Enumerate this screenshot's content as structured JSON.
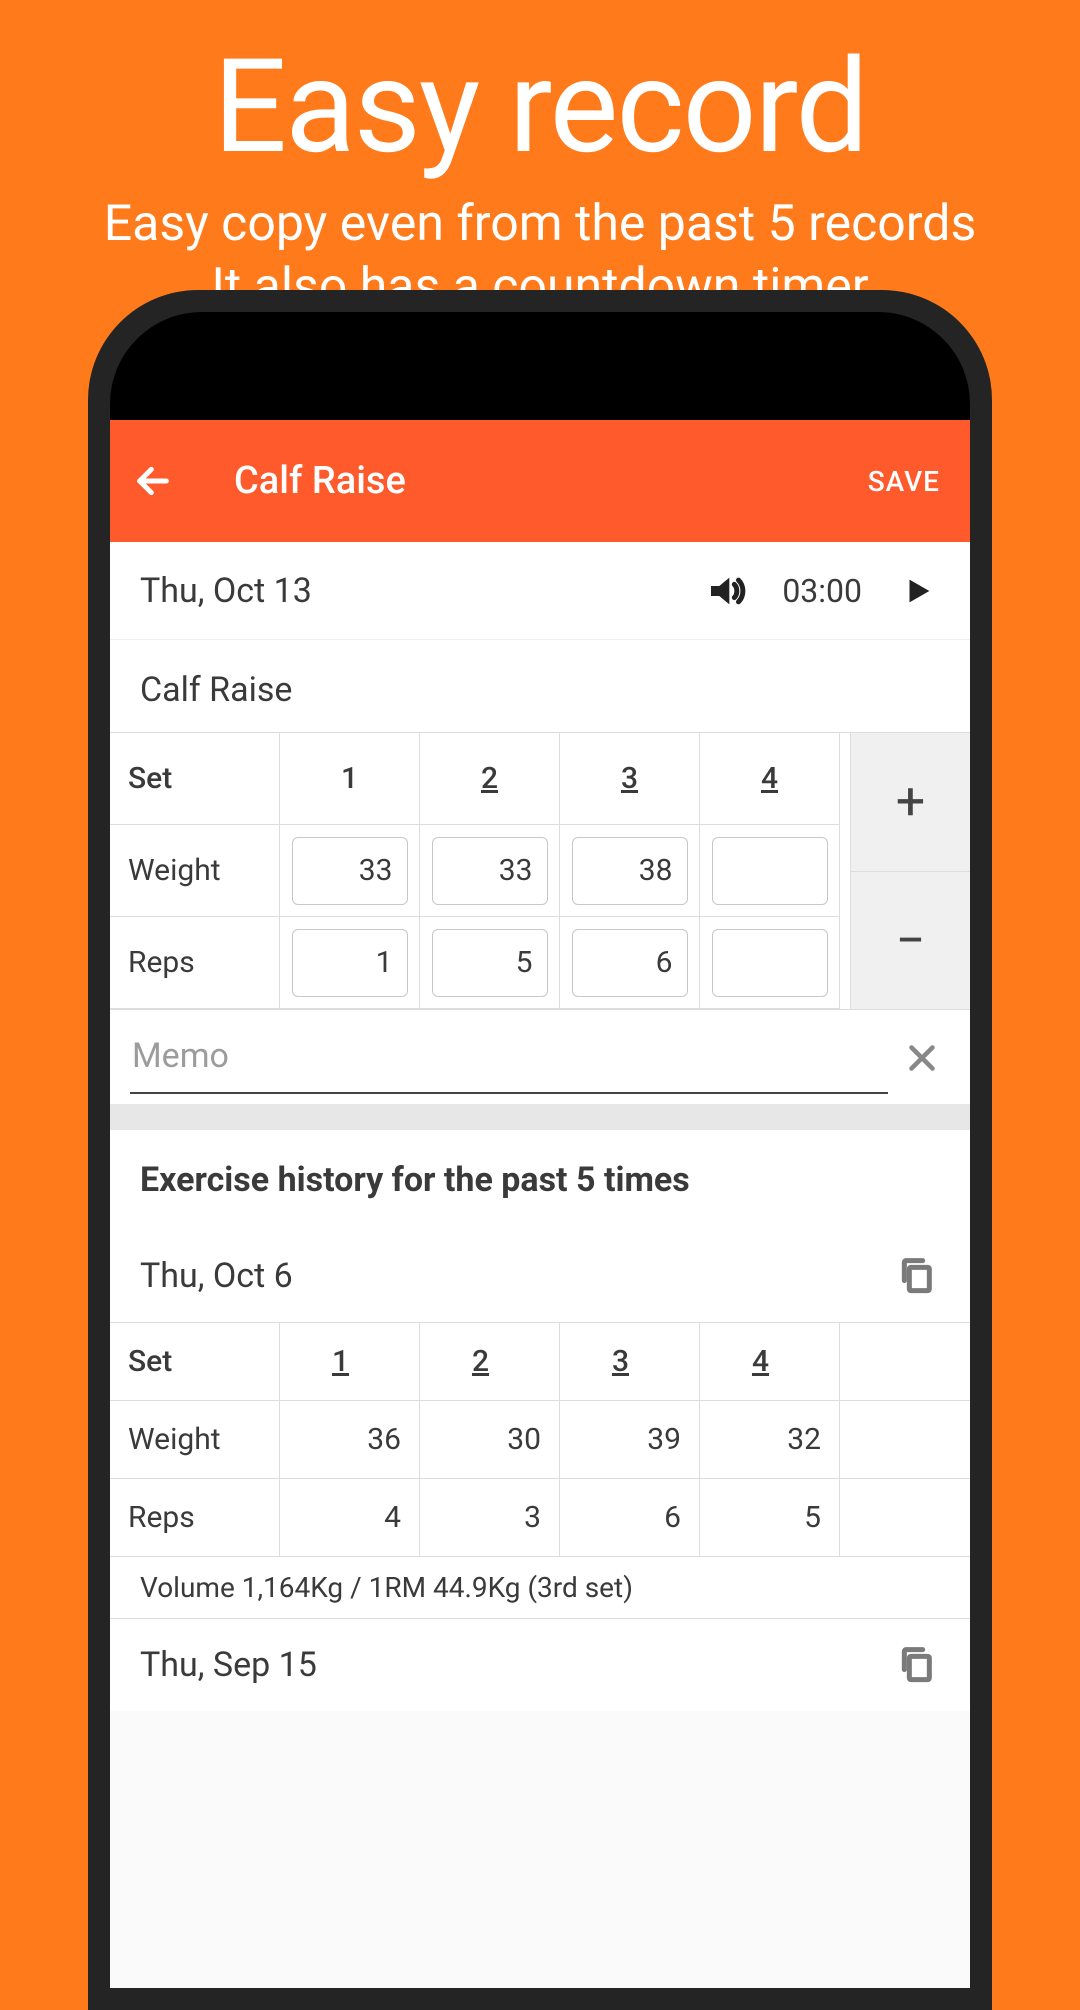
{
  "promo": {
    "title": "Easy record",
    "line1": "Easy copy even from the past 5 records",
    "line2": "It also has a countdown timer"
  },
  "appbar": {
    "title": "Calf Raise",
    "save": "SAVE"
  },
  "date_row": {
    "date": "Thu, Oct 13",
    "timer": "03:00"
  },
  "exercise_name": "Calf Raise",
  "labels": {
    "set": "Set",
    "weight": "Weight",
    "reps": "Reps"
  },
  "current": {
    "set_headers": [
      "1",
      "2",
      "3",
      "4"
    ],
    "set_underline": [
      false,
      true,
      true,
      true
    ],
    "weight": [
      "33",
      "33",
      "38",
      ""
    ],
    "reps": [
      "1",
      "5",
      "6",
      ""
    ]
  },
  "controls": {
    "plus": "+",
    "minus": "−"
  },
  "memo": {
    "placeholder": "Memo"
  },
  "history": {
    "title": "Exercise history for the past 5 times",
    "entries": [
      {
        "date": "Thu, Oct 6",
        "set_headers": [
          "1",
          "2",
          "3",
          "4"
        ],
        "weight": [
          "36",
          "30",
          "39",
          "32"
        ],
        "reps": [
          "4",
          "3",
          "6",
          "5"
        ],
        "volume": "Volume 1,164Kg / 1RM 44.9Kg (3rd set)"
      },
      {
        "date": "Thu, Sep 15"
      }
    ]
  }
}
